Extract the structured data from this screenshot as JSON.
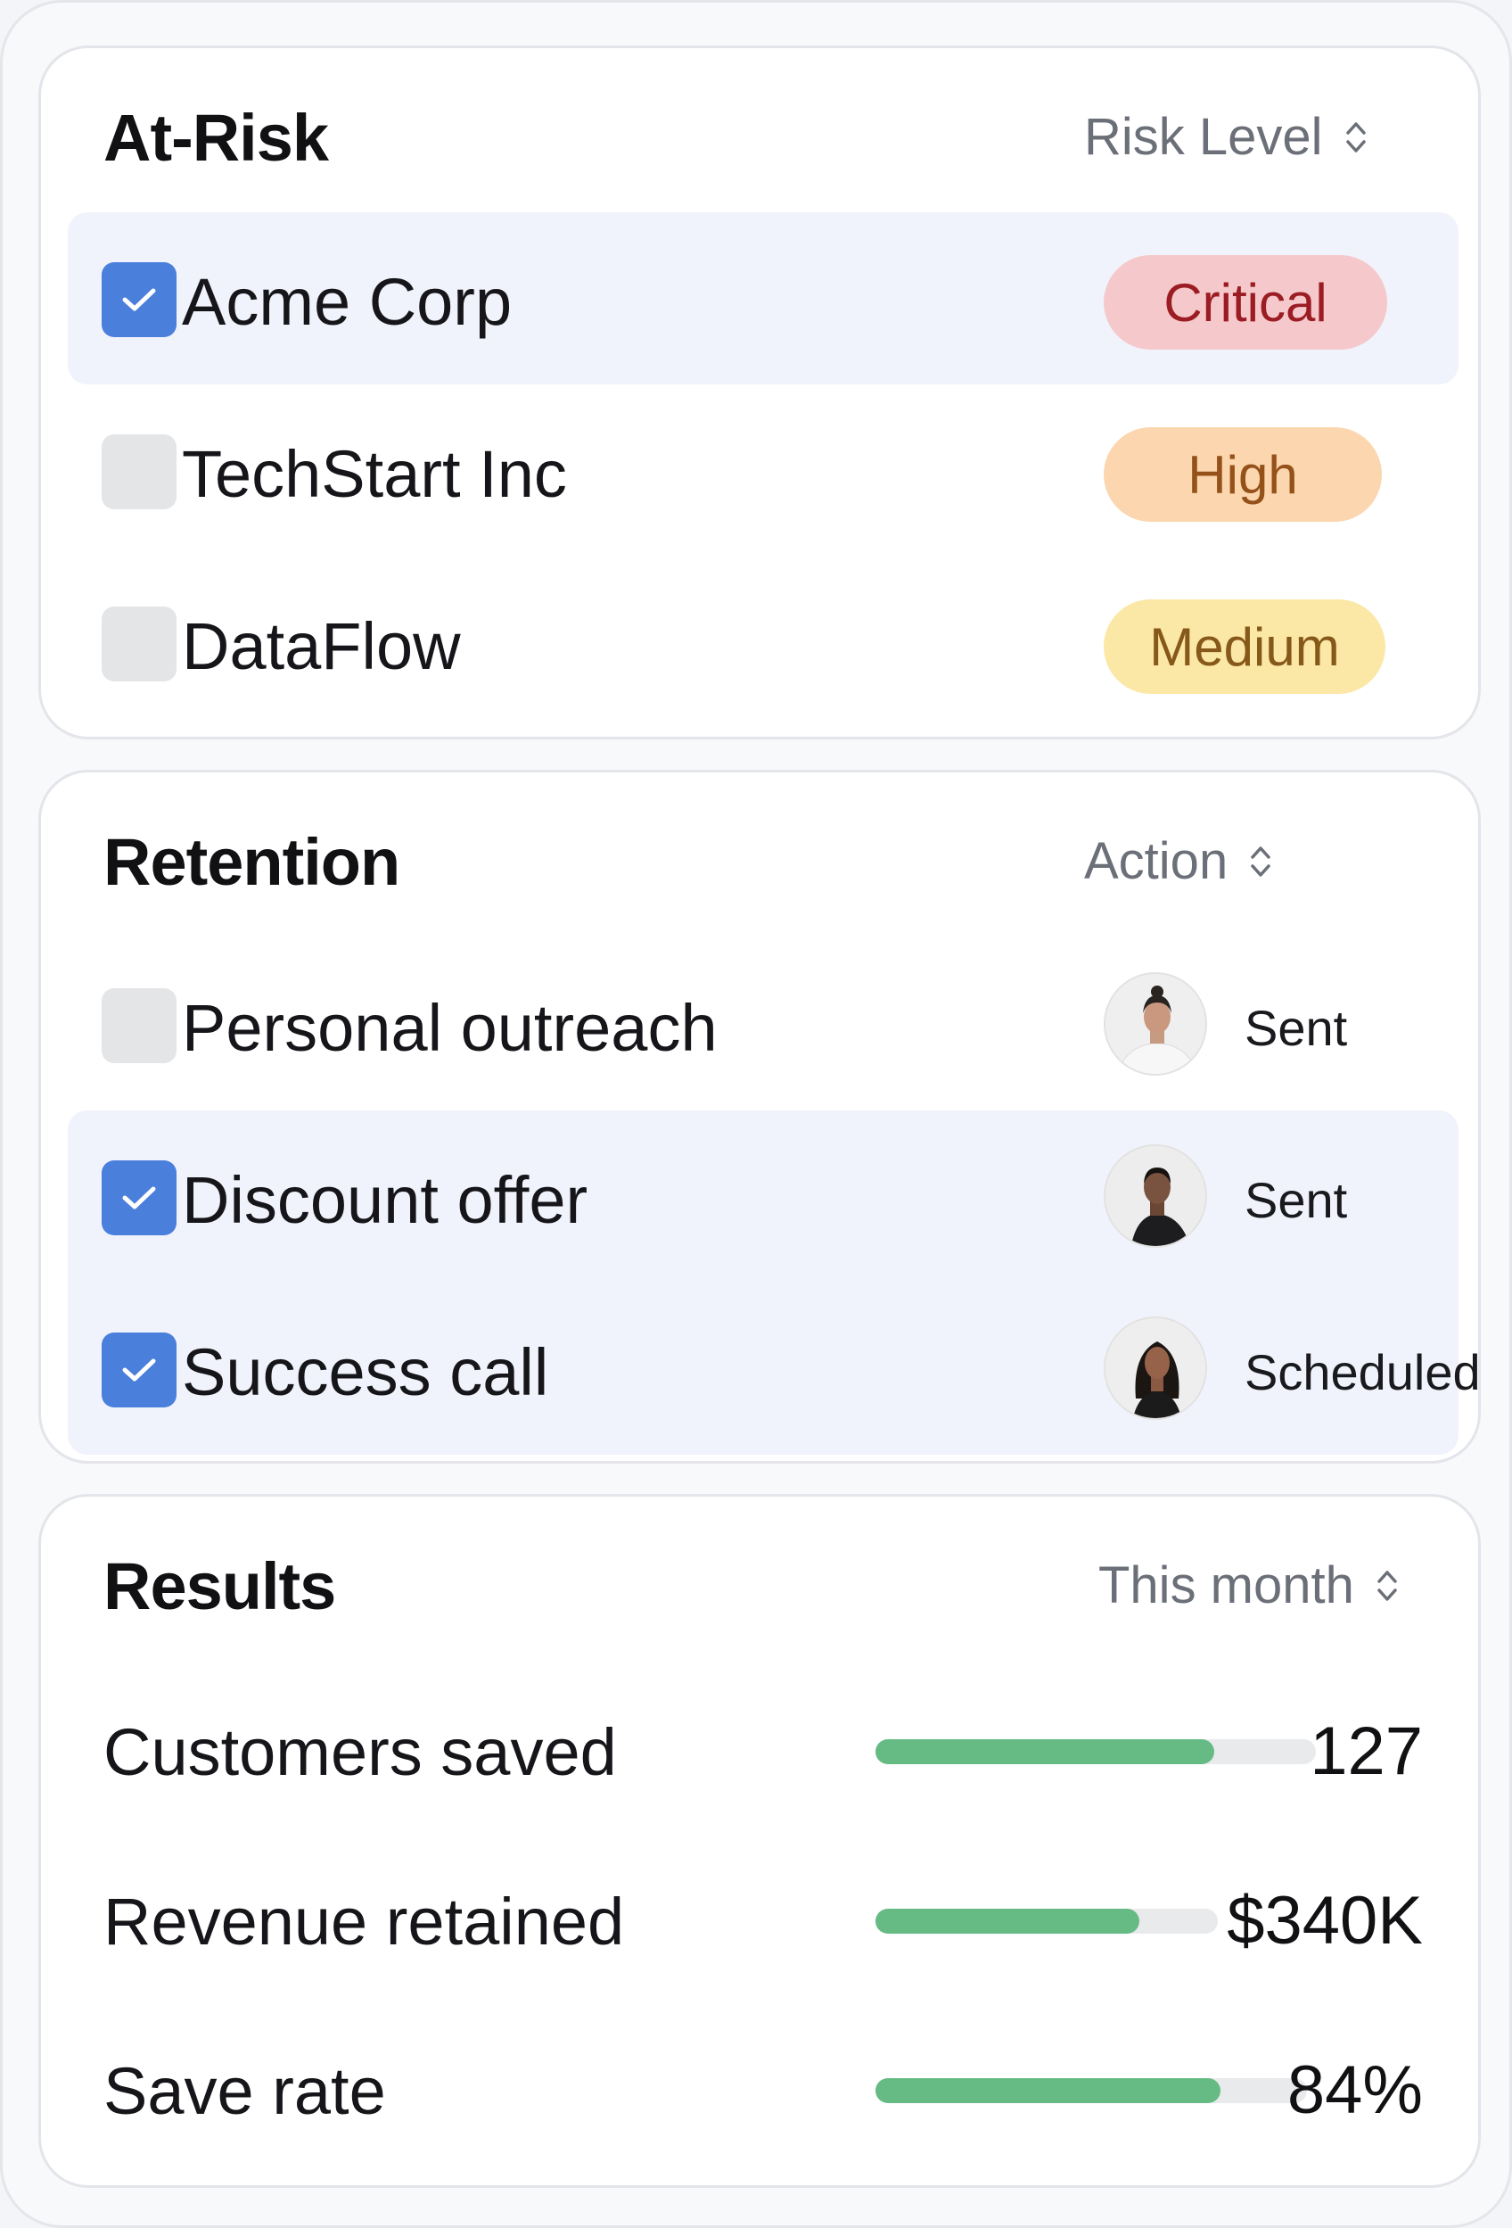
{
  "at_risk": {
    "title": "At-Risk",
    "sort_label": "Risk Level",
    "rows": [
      {
        "name": "Acme Corp",
        "checked": true,
        "level": "Critical"
      },
      {
        "name": "TechStart Inc",
        "checked": false,
        "level": "High"
      },
      {
        "name": "DataFlow",
        "checked": false,
        "level": "Medium"
      }
    ]
  },
  "retention": {
    "title": "Retention",
    "sort_label": "Action",
    "rows": [
      {
        "name": "Personal outreach",
        "checked": false,
        "status": "Sent",
        "avatar": "avatar-woman-light-top"
      },
      {
        "name": "Discount offer",
        "checked": true,
        "status": "Sent",
        "avatar": "avatar-man-dark-jacket"
      },
      {
        "name": "Success call",
        "checked": true,
        "status": "Scheduled",
        "avatar": "avatar-woman-dark-hair"
      }
    ]
  },
  "results": {
    "title": "Results",
    "period_label": "This month",
    "metrics": [
      {
        "label": "Customers saved",
        "value": "127",
        "progress": 0.77
      },
      {
        "label": "Revenue retained",
        "value": "$340K",
        "progress": 0.77
      },
      {
        "label": "Save rate",
        "value": "84%",
        "progress": 0.8
      }
    ]
  },
  "colors": {
    "checkbox_checked": "#4a7fdc",
    "checkbox_unchecked": "#e4e5e7",
    "critical_bg": "#f5c9cb",
    "high_bg": "#fbd6ae",
    "medium_bg": "#fbe8a6",
    "progress_fill": "#66bb84",
    "selected_row": "#f0f3fb"
  }
}
